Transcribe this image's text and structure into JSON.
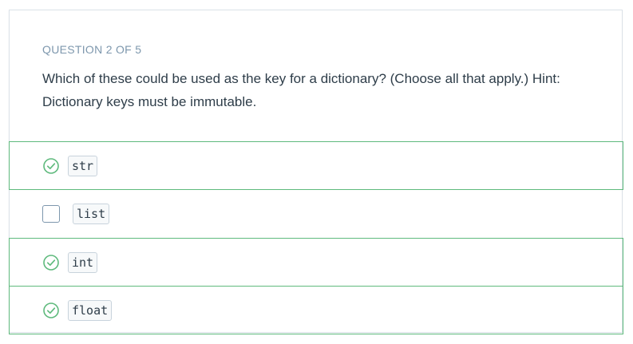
{
  "quiz": {
    "progress_label": "QUESTION 2 OF 5",
    "prompt": "Which of these could be used as the key for a dictionary? (Choose all that apply.) Hint: Dictionary keys must be immutable.",
    "options": [
      {
        "label": "str",
        "selected": true,
        "icon": "check-circle-icon"
      },
      {
        "label": "list",
        "selected": false,
        "icon": "checkbox-empty-icon"
      },
      {
        "label": "int",
        "selected": true,
        "icon": "check-circle-icon"
      },
      {
        "label": "float",
        "selected": true,
        "icon": "check-circle-icon"
      }
    ]
  },
  "colors": {
    "accent_green": "#5fba7d",
    "muted_text": "#7d97ad",
    "body_text": "#2e3d49",
    "border": "#dbe2e8"
  }
}
